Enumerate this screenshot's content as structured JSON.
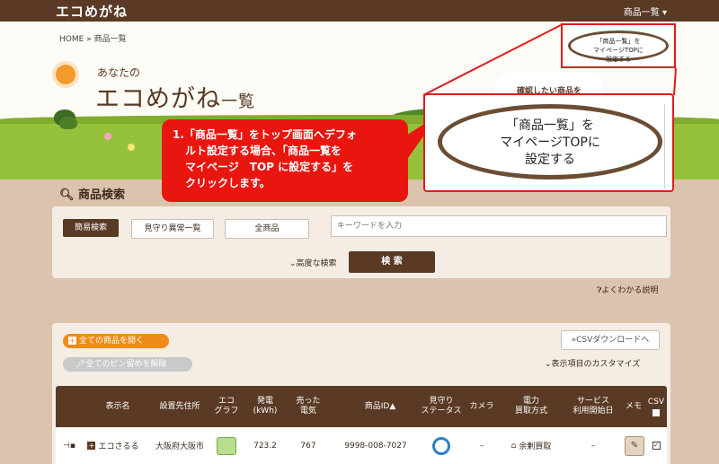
{
  "topbar": {
    "logo": "エコめがね",
    "menu_label": "商品一覧 ▾"
  },
  "breadcrumb": {
    "home": "HOME",
    "sep": "»",
    "current": "商品一覧"
  },
  "header": {
    "title_sub": "あなたの",
    "title_main": "エコめがね",
    "title_suffix": "一覧",
    "bubble_text": "確認したい商品を"
  },
  "set_top_button": {
    "line1": "「商品一覧」を",
    "line2": "マイページTOPに",
    "line3": "設定する"
  },
  "callout": {
    "lines": [
      "1.「商品一覧」をトップ画面へデフォ",
      "ルト設定する場合、「商品一覧を",
      "マイページ　TOP に設定する」を",
      "クリックします。"
    ]
  },
  "search": {
    "section_title": "商品検索",
    "tab_simple": "簡易検索",
    "tab_alert": "見守り異常一覧",
    "tab_all": "全商品",
    "keyword_placeholder": "キーワードを入力",
    "advanced_label": "⌄高度な検索",
    "search_button": "検 索"
  },
  "help_link": "よくわかる説明",
  "list": {
    "open_all": "全ての商品を開く",
    "unpin_all": "全てのピン留めを解除",
    "csv_download": "CSVダウンロードへ",
    "customize": "表示項目のカスタマイズ",
    "columns": [
      "表示名",
      "設置先住所",
      "エコ\nグラフ",
      "発電\n(kWh)",
      "売った\n電気",
      "商品ID▲",
      "見守り\nステータス",
      "カメラ",
      "電力\n買取方式",
      "サービス\n利用開始日",
      "メモ",
      "CSV"
    ],
    "rows": [
      {
        "name": "エコさるる",
        "address": "大阪府大阪市",
        "kwh": "723.2",
        "sold": "767",
        "product_id": "9998-008-7027",
        "camera": "–",
        "purchase": "余剰買取",
        "service_start": "–"
      }
    ]
  },
  "colors": {
    "brown": "#5a3a24",
    "accent_red": "#e01b1b",
    "orange": "#f08a18",
    "grass": "#95c23a"
  }
}
